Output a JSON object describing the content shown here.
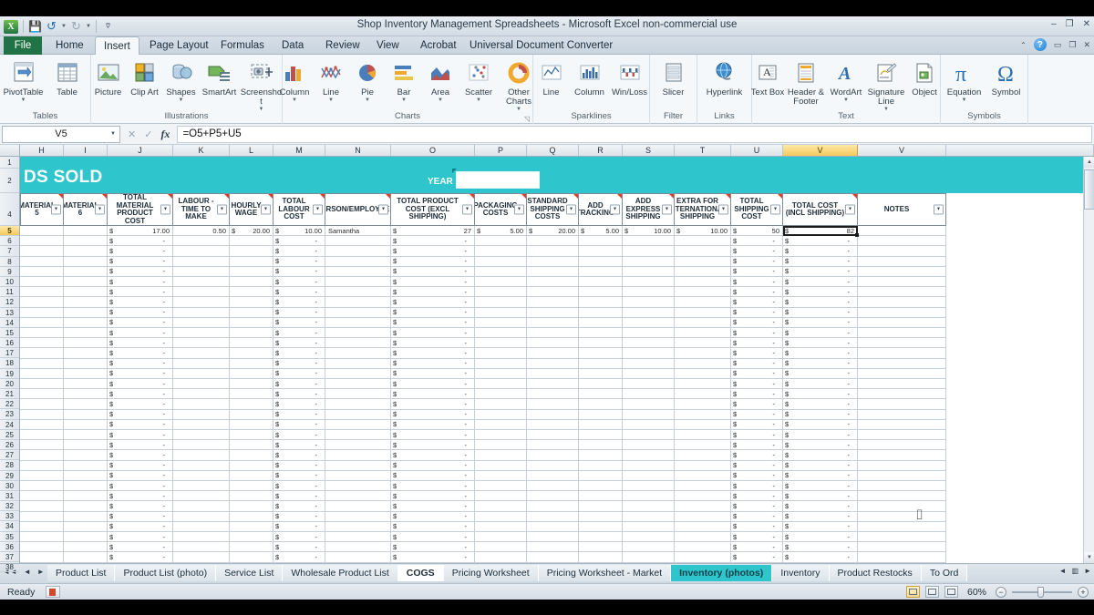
{
  "window": {
    "title": "Shop Inventory Management Spreadsheets  -  Microsoft Excel non-commercial use",
    "minimize": "–",
    "restore": "❐",
    "close": "✕"
  },
  "quick_access": {
    "logo": "X",
    "save": "save-icon",
    "undo": "undo-icon",
    "redo": "redo-icon",
    "customize": "customize-icon"
  },
  "ribbon_tabs": [
    {
      "label": "File"
    },
    {
      "label": "Home"
    },
    {
      "label": "Insert"
    },
    {
      "label": "Page Layout"
    },
    {
      "label": "Formulas"
    },
    {
      "label": "Data"
    },
    {
      "label": "Review"
    },
    {
      "label": "View"
    },
    {
      "label": "Acrobat"
    },
    {
      "label": "Universal Document Converter"
    }
  ],
  "ribbon_active_tab": "Insert",
  "ribbon_groups": [
    {
      "label": "Tables",
      "items": [
        {
          "label": "PivotTable",
          "icon": "pivot-table-icon",
          "caret": true
        },
        {
          "label": "Table",
          "icon": "table-icon",
          "caret": false
        }
      ]
    },
    {
      "label": "Illustrations",
      "items": [
        {
          "label": "Picture",
          "icon": "picture-icon",
          "caret": false
        },
        {
          "label": "Clip Art",
          "icon": "clip-art-icon",
          "caret": false
        },
        {
          "label": "Shapes",
          "icon": "shapes-icon",
          "caret": true
        },
        {
          "label": "SmartArt",
          "icon": "smartart-icon",
          "caret": false
        },
        {
          "label": "Screenshot",
          "icon": "screenshot-icon",
          "caret": true
        }
      ]
    },
    {
      "label": "Charts",
      "items": [
        {
          "label": "Column",
          "icon": "column-chart-icon",
          "caret": true
        },
        {
          "label": "Line",
          "icon": "line-chart-icon",
          "caret": true
        },
        {
          "label": "Pie",
          "icon": "pie-chart-icon",
          "caret": true
        },
        {
          "label": "Bar",
          "icon": "bar-chart-icon",
          "caret": true
        },
        {
          "label": "Area",
          "icon": "area-chart-icon",
          "caret": true
        },
        {
          "label": "Scatter",
          "icon": "scatter-chart-icon",
          "caret": true
        },
        {
          "label": "Other Charts",
          "icon": "other-charts-icon",
          "caret": true
        }
      ]
    },
    {
      "label": "Sparklines",
      "items": [
        {
          "label": "Line",
          "icon": "sparkline-line-icon",
          "caret": false
        },
        {
          "label": "Column",
          "icon": "sparkline-column-icon",
          "caret": false
        },
        {
          "label": "Win/Loss",
          "icon": "sparkline-winloss-icon",
          "caret": false
        }
      ]
    },
    {
      "label": "Filter",
      "items": [
        {
          "label": "Slicer",
          "icon": "slicer-icon",
          "caret": false
        }
      ]
    },
    {
      "label": "Links",
      "items": [
        {
          "label": "Hyperlink",
          "icon": "hyperlink-icon",
          "caret": false
        }
      ]
    },
    {
      "label": "Text",
      "items": [
        {
          "label": "Text Box",
          "icon": "text-box-icon",
          "caret": false
        },
        {
          "label": "Header & Footer",
          "icon": "header-footer-icon",
          "caret": false
        },
        {
          "label": "WordArt",
          "icon": "wordart-icon",
          "caret": true
        },
        {
          "label": "Signature Line",
          "icon": "signature-line-icon",
          "caret": true
        },
        {
          "label": "Object",
          "icon": "object-icon",
          "caret": false
        }
      ]
    },
    {
      "label": "Symbols",
      "items": [
        {
          "label": "Equation",
          "icon": "equation-icon",
          "caret": true
        },
        {
          "label": "Symbol",
          "icon": "symbol-icon",
          "caret": false
        }
      ]
    }
  ],
  "formula_bar": {
    "name_box": "V5",
    "formula": "=O5+P5+U5",
    "cancel": "✕",
    "enter": "✓",
    "fx": "fx"
  },
  "grid": {
    "column_letters": [
      "H",
      "I",
      "J",
      "K",
      "L",
      "M",
      "N",
      "O",
      "P",
      "Q",
      "R",
      "S",
      "T",
      "U",
      "V",
      "V"
    ],
    "selected_column": "V",
    "row_numbers": [
      5,
      6,
      7,
      8,
      9,
      10,
      11,
      12,
      13,
      14,
      15,
      16,
      17,
      18,
      19,
      20,
      21,
      22,
      23,
      24,
      25,
      26,
      27,
      28,
      29,
      30,
      31,
      32,
      33,
      34,
      35,
      36,
      37,
      38
    ],
    "selected_row": 5,
    "banner": {
      "title": "DS SOLD",
      "year_label": "YEAR",
      "year_value": ""
    },
    "headers": [
      "MATERIAL 5",
      "MATERIAL 6",
      "TOTAL MATERIAL PRODUCT COST",
      "LABOUR - TIME TO MAKE",
      "HOURLY WAGE",
      "TOTAL LABOUR COST",
      "PERSON/EMPLOYEE",
      "TOTAL PRODUCT COST (EXCL SHIPPING)",
      "PACKAGING COSTS",
      "STANDARD SHIPPING COSTS",
      "ADD TRACKING",
      "ADD EXPRESS SHIPPING",
      "EXTRA FOR INTERNATIONAL SHIPPING",
      "TOTAL SHIPPING COST",
      "TOTAL COST (INCL SHIPPING)",
      "NOTES"
    ],
    "row5": [
      {
        "dollar": "",
        "value": ""
      },
      {
        "dollar": "",
        "value": ""
      },
      {
        "dollar": "$",
        "value": "17.00"
      },
      {
        "dollar": "",
        "value": "0.50"
      },
      {
        "dollar": "$",
        "value": "20.00"
      },
      {
        "dollar": "$",
        "value": "10.00"
      },
      {
        "dollar": "",
        "value": "Samantha"
      },
      {
        "dollar": "$",
        "value": "27"
      },
      {
        "dollar": "$",
        "value": "5.00"
      },
      {
        "dollar": "$",
        "value": "20.00"
      },
      {
        "dollar": "$",
        "value": "5.00"
      },
      {
        "dollar": "$",
        "value": "10.00"
      },
      {
        "dollar": "$",
        "value": "10.00"
      },
      {
        "dollar": "$",
        "value": "50"
      },
      {
        "dollar": "$",
        "value": "82"
      },
      {
        "dollar": "",
        "value": ""
      }
    ],
    "empty_dash": "-",
    "empty_dollar": "$",
    "selected_cell": "V5"
  },
  "sheet_tabs": [
    {
      "label": "Product List",
      "state": "normal"
    },
    {
      "label": "Product List (photo)",
      "state": "normal"
    },
    {
      "label": "Service List",
      "state": "normal"
    },
    {
      "label": "Wholesale Product List",
      "state": "normal"
    },
    {
      "label": "COGS",
      "state": "active"
    },
    {
      "label": "Pricing Worksheet",
      "state": "normal"
    },
    {
      "label": "Pricing Worksheet - Market",
      "state": "normal"
    },
    {
      "label": "Inventory (photos)",
      "state": "teal"
    },
    {
      "label": "Inventory",
      "state": "normal"
    },
    {
      "label": "Product Restocks",
      "state": "normal"
    },
    {
      "label": "To Ord",
      "state": "normal"
    }
  ],
  "sheet_nav": {
    "first": "◄◄",
    "prev": "◄",
    "next": "►",
    "last": "►►"
  },
  "status_bar": {
    "mode": "Ready",
    "macro_icon": "record-macro-icon",
    "view_normal": "normal-view-icon",
    "view_page_layout": "page-layout-view-icon",
    "view_page_break": "page-break-view-icon",
    "zoom": "60%",
    "zoom_out": "−",
    "zoom_in": "+"
  },
  "colors": {
    "accent_teal": "#2ec5cd",
    "excel_green": "#217346",
    "selection_gold": "#f5c95c"
  }
}
